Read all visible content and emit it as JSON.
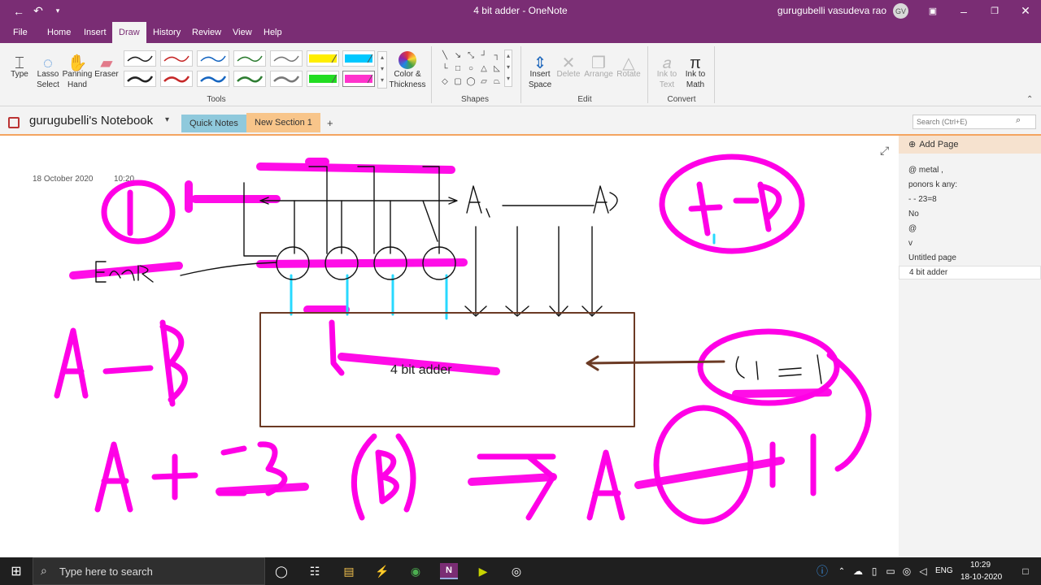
{
  "window": {
    "title": "4 bit adder  -  OneNote",
    "user": "gurugubelli vasudeva rao",
    "avatar": "GV"
  },
  "ribbon_tabs": [
    "File",
    "Home",
    "Insert",
    "Draw",
    "History",
    "Review",
    "View",
    "Help"
  ],
  "ribbon": {
    "tools": {
      "type": "Type",
      "lasso": "Lasso Select",
      "panning": "Panning Hand",
      "eraser": "Eraser",
      "color": "Color & Thickness",
      "label": "Tools"
    },
    "shapes_label": "Shapes",
    "edit": {
      "insert_space": "Insert Space",
      "delete": "Delete",
      "arrange": "Arrange",
      "rotate": "Rotate",
      "label": "Edit"
    },
    "convert": {
      "ink_text": "Ink to Text",
      "ink_math": "Ink to Math",
      "label": "Convert"
    },
    "pen_colors": [
      "#222222",
      "#c62828",
      "#1565c0",
      "#2e7d32",
      "#777777",
      "#ffee00",
      "#00c8ff",
      "#222222",
      "#c62828",
      "#1565c0",
      "#2e7d32",
      "#777777",
      "#22dd22",
      "#ff33cc"
    ]
  },
  "notebook": {
    "name": "gurugubelli's Notebook",
    "sections": [
      "Quick Notes",
      "New Section 1"
    ],
    "add_section": "+",
    "search_placeholder": "Search (Ctrl+E)"
  },
  "page": {
    "date": "18 October 2020",
    "time": "10:20",
    "adder_label": "4 bit adder"
  },
  "pages_panel": {
    "add_page": "Add Page",
    "items": [
      "@ metal  ,",
      "ponors k any:",
      "- - 23=8",
      "No",
      "@",
      "v",
      "Untitled page",
      "4 bit adder"
    ],
    "active_index": 7
  },
  "taskbar": {
    "search": "Type here to search",
    "lang": "ENG",
    "time": "10:29",
    "date": "18-10-2020"
  },
  "colors": {
    "accent": "#7a2d74",
    "ink_magenta": "#ff00e6",
    "ink_cyan": "#28d9ff",
    "box_brown": "#6b3a24"
  }
}
